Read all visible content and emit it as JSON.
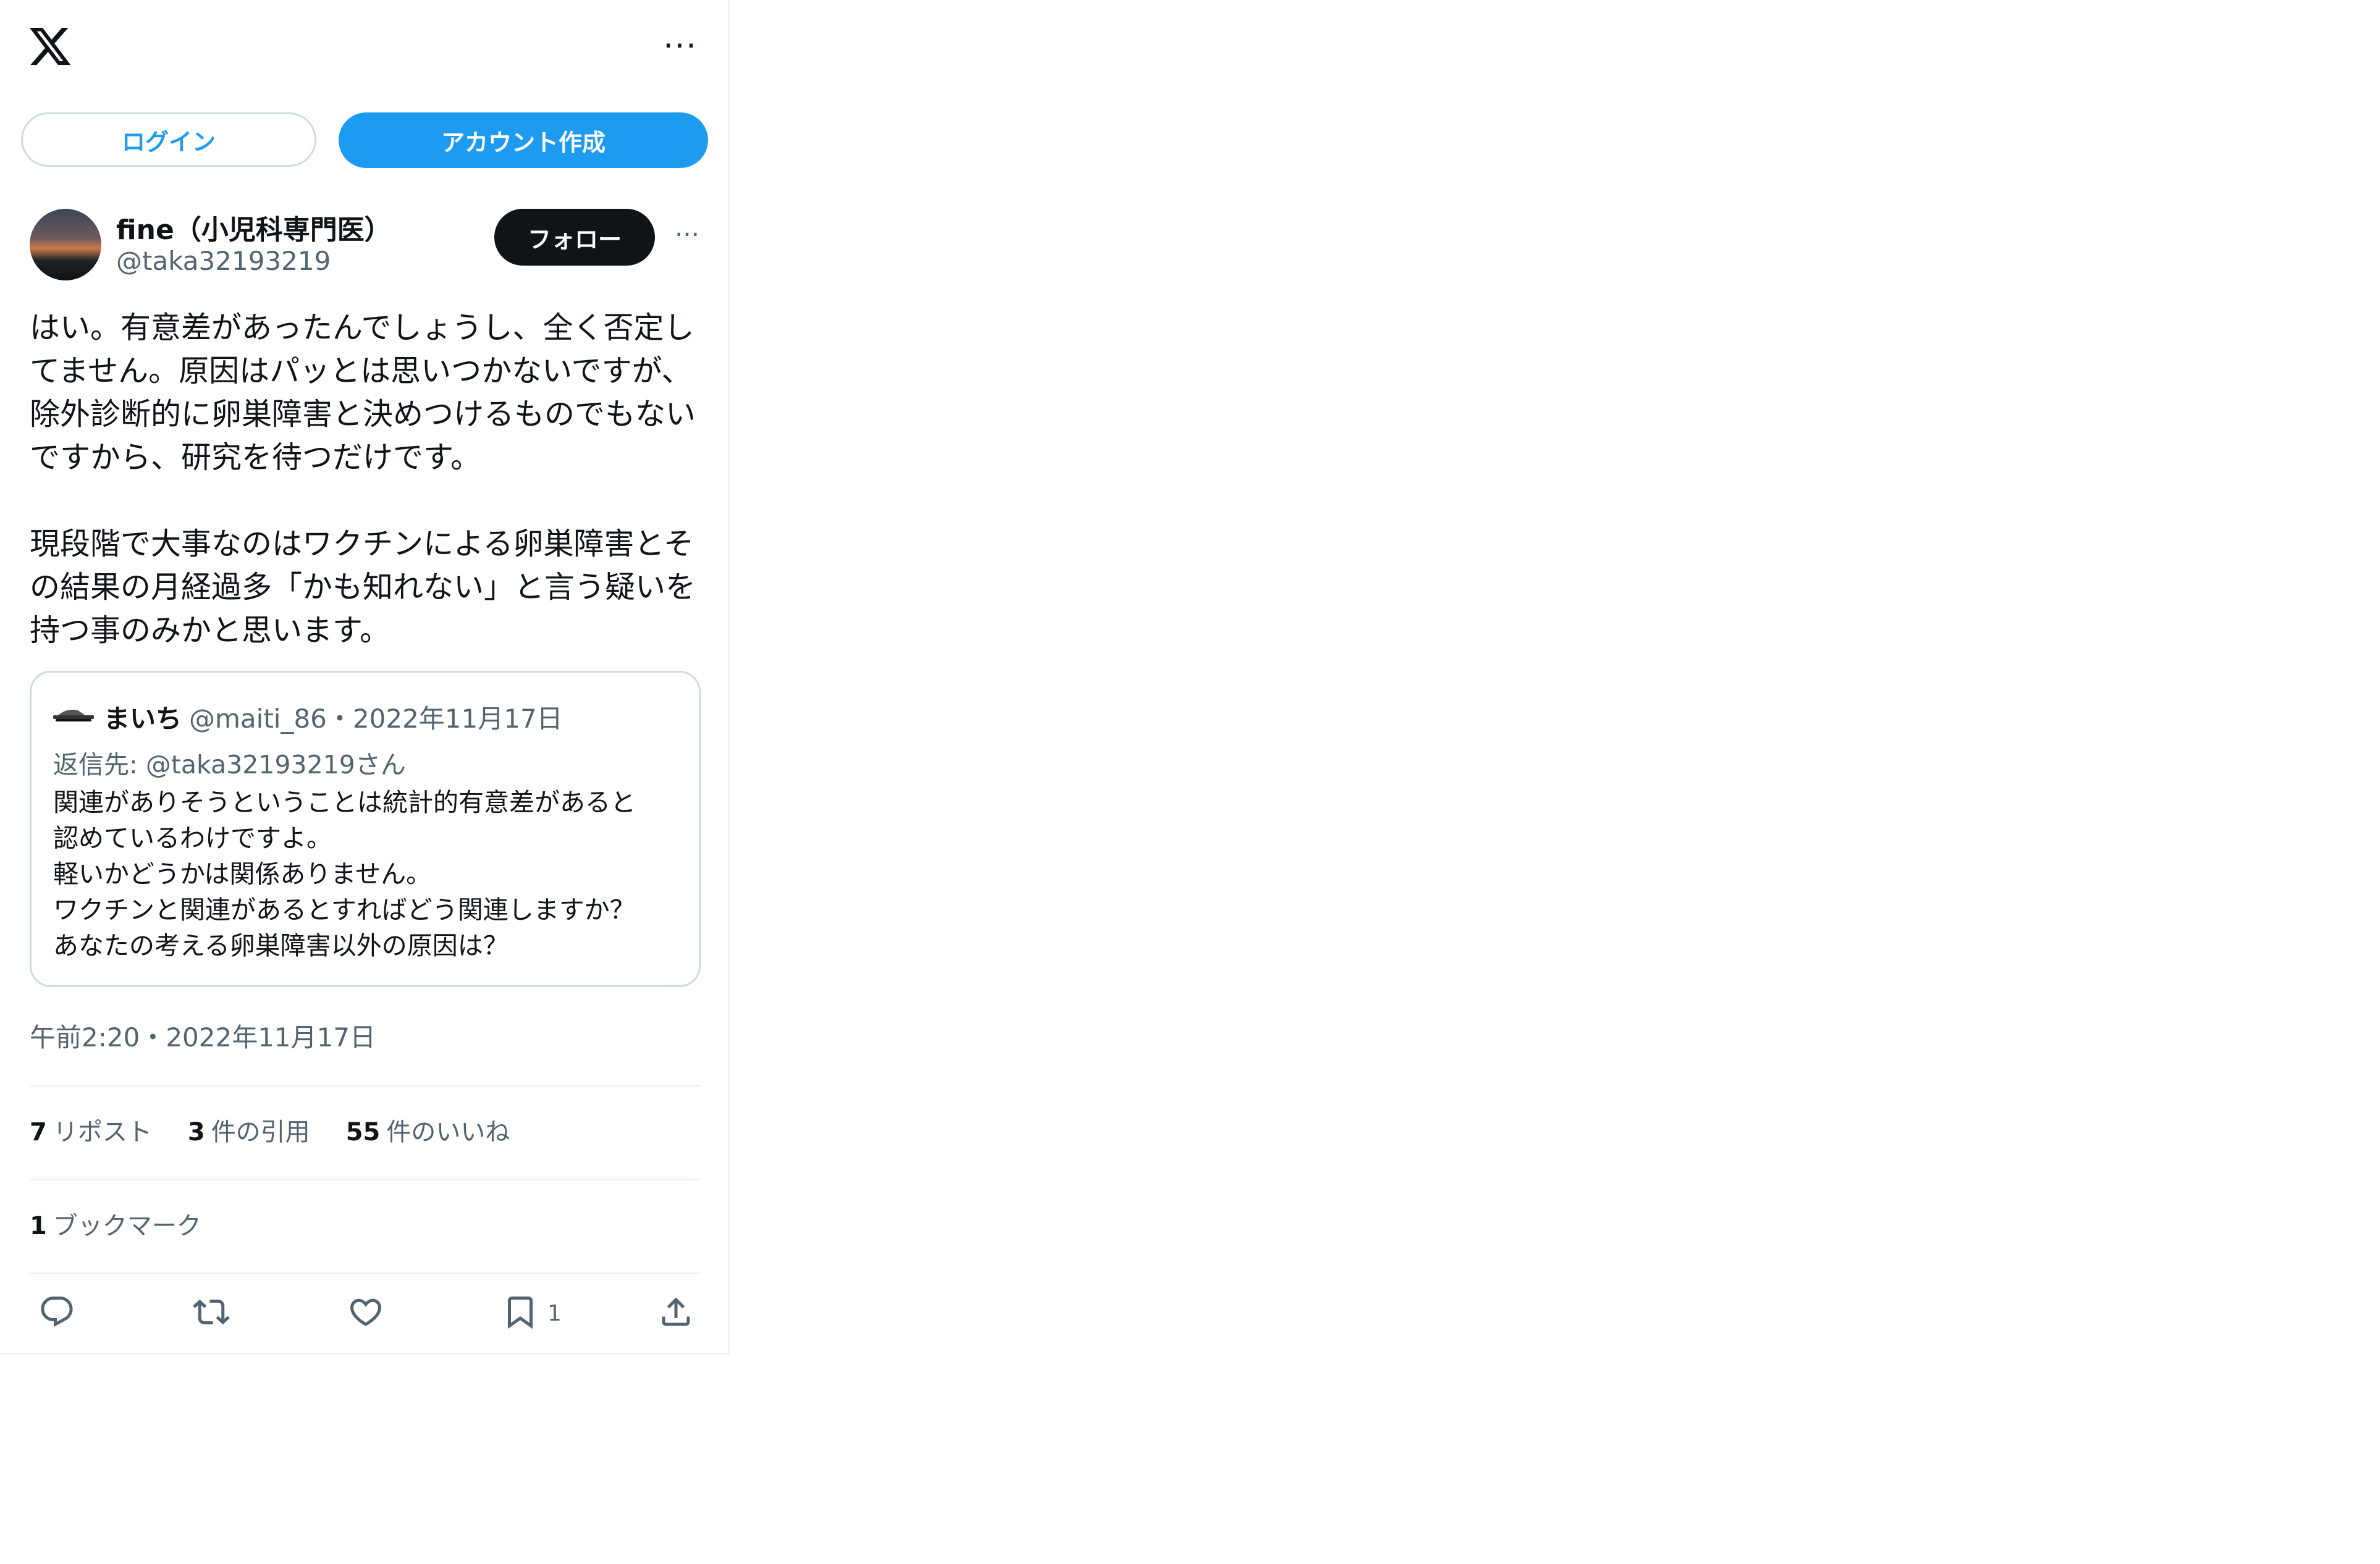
{
  "header": {
    "logo": "x-logo-icon",
    "more": "···"
  },
  "auth": {
    "login_label": "ログイン",
    "signup_label": "アカウント作成"
  },
  "author": {
    "name": "fine（小児科専門医）",
    "handle": "@taka32193219",
    "follow_label": "フォロー"
  },
  "tweet": {
    "text": "はい。有意差があったんでしょうし、全く否定し\nてません。原因はパッとは思いつかないですが、\n除外診断的に卵巣障害と決めつけるものでもない\nですから、研究を待つだけです。\n\n現段階で大事なのはワクチンによる卵巣障害とそ\nの結果の月経過多「かも知れない」と言う疑いを\n持つ事のみかと思います。",
    "timestamp": "午前2:20・2022年11月17日"
  },
  "quote": {
    "name": "まいち",
    "handle_date": "@maiti_86・2022年11月17日",
    "reply_to": "返信先: @taka32193219さん",
    "text": "関連がありそうということは統計的有意差があると\n認めているわけですよ。\n軽いかどうかは関係ありません。\nワクチンと関連があるとすればどう関連しますか？\nあなたの考える卵巣障害以外の原因は？"
  },
  "stats": {
    "reposts_count": "7",
    "reposts_label": "リポスト",
    "quotes_count": "3",
    "quotes_label": "件の引用",
    "likes_count": "55",
    "likes_label": "件のいいね",
    "bookmarks_count": "1",
    "bookmarks_label": "ブックマーク"
  },
  "actions": {
    "reply_icon": "reply-icon",
    "repost_icon": "repost-icon",
    "like_icon": "heart-icon",
    "bookmark_icon": "bookmark-icon",
    "bookmark_count": "1",
    "share_icon": "share-icon"
  },
  "colors": {
    "accent": "#1d9bf0",
    "text": "#0f1419",
    "secondary": "#536471",
    "border": "#cfd9de"
  }
}
